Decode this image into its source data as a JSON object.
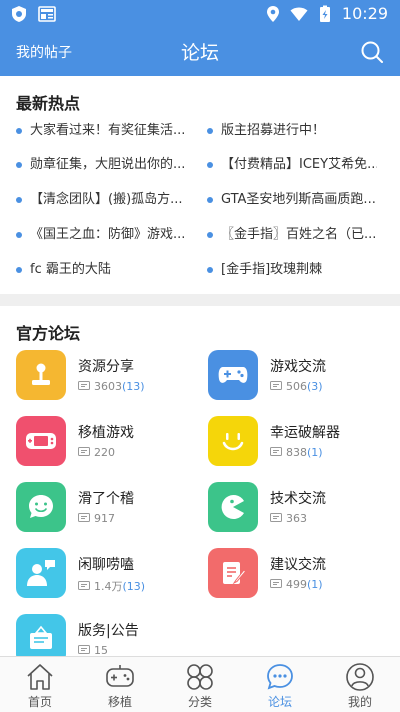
{
  "status": {
    "time": "10:29"
  },
  "nav": {
    "my_posts": "我的帖子",
    "title": "论坛"
  },
  "hot": {
    "title": "最新热点",
    "items": [
      "大家看过来！有奖征集活...",
      "版主招募进行中！",
      "勋章征集，大胆说出你的...",
      "【付费精品】ICEY艾希免...",
      "【清念团队】(搬)孤岛方...",
      "GTA圣安地列斯高画质跑...",
      "《国王之血：防御》游戏...",
      "〖金手指〗百姓之名（已...",
      "fc 霸王的大陆",
      "[金手指]玫瑰荆棘"
    ]
  },
  "official": {
    "title": "官方论坛",
    "forums": [
      {
        "name": "资源分享",
        "count": "3603",
        "new": "(13)",
        "color": "#f5b731",
        "icon": "joystick-icon"
      },
      {
        "name": "游戏交流",
        "count": "506",
        "new": "(3)",
        "color": "#4a90e2",
        "icon": "gamepad-icon"
      },
      {
        "name": "移植游戏",
        "count": "220",
        "new": "",
        "color": "#f0506e",
        "icon": "handheld-icon"
      },
      {
        "name": "幸运破解器",
        "count": "838",
        "new": "(1)",
        "color": "#f5d60a",
        "icon": "smiley-icon"
      },
      {
        "name": "滑了个稽",
        "count": "917",
        "new": "",
        "color": "#3cc48a",
        "icon": "chat-face-icon"
      },
      {
        "name": "技术交流",
        "count": "363",
        "new": "",
        "color": "#3cc48a",
        "icon": "pacman-icon"
      },
      {
        "name": "闲聊唠嗑",
        "count": "1.4万",
        "new": "(13)",
        "color": "#43c6e8",
        "icon": "person-chat-icon"
      },
      {
        "name": "建议交流",
        "count": "499",
        "new": "(1)",
        "color": "#f26b6b",
        "icon": "note-pencil-icon"
      },
      {
        "name": "版务|公告",
        "count": "15",
        "new": "",
        "color": "#43c6e8",
        "icon": "notice-board-icon"
      }
    ]
  },
  "tabs": [
    {
      "label": "首页",
      "icon": "home-icon"
    },
    {
      "label": "移植",
      "icon": "gamepad-outline-icon"
    },
    {
      "label": "分类",
      "icon": "grid-petals-icon"
    },
    {
      "label": "论坛",
      "icon": "forum-bubble-icon",
      "active": true
    },
    {
      "label": "我的",
      "icon": "user-icon"
    }
  ],
  "colors": {
    "primary": "#4a90e2",
    "active_tab": "#4a90e2"
  }
}
